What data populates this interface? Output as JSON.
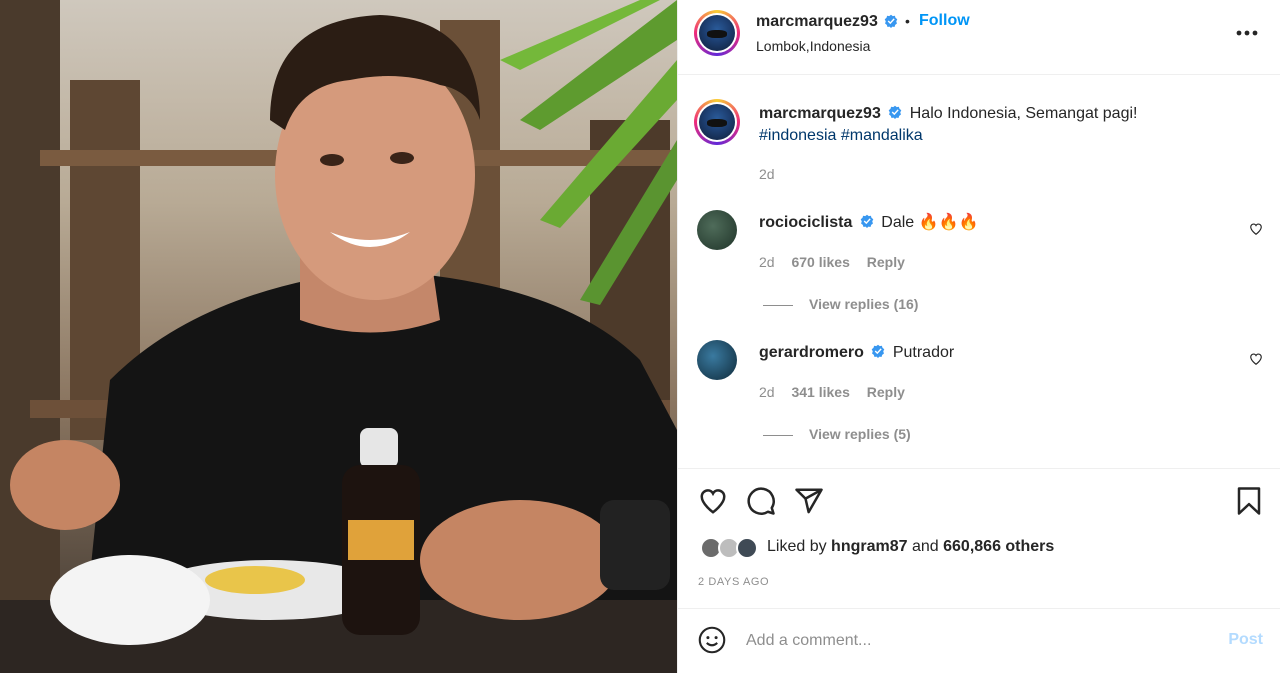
{
  "post": {
    "author": "marcmarquez93",
    "follow_label": "Follow",
    "separator": "•",
    "location": "Lombok,Indonesia",
    "more_label": "•••",
    "caption_text": "Halo Indonesia, Semangat pagi!",
    "hashtags": "#indonesia #mandalika",
    "caption_time": "2d"
  },
  "comments": [
    {
      "user": "rociociclista",
      "text": "Dale 🔥🔥🔥",
      "time": "2d",
      "likes": "670 likes",
      "reply_label": "Reply",
      "view_replies": "View replies (16)"
    },
    {
      "user": "gerardromero",
      "text": "Putrador",
      "time": "2d",
      "likes": "341 likes",
      "reply_label": "Reply",
      "view_replies": "View replies (5)"
    }
  ],
  "engagement": {
    "liked_by_prefix": "Liked by",
    "liked_by_user": "hngram87",
    "and_label": "and",
    "others_count": "660,866 others",
    "posted_ago": "2 DAYS AGO"
  },
  "comment_box": {
    "placeholder": "Add a comment...",
    "post_label": "Post"
  },
  "colors": {
    "accent": "#0095f6",
    "verified": "#3897f0",
    "hashtag": "#00376b",
    "muted": "#8e8e8e"
  },
  "icons": [
    "verified-icon",
    "more-icon",
    "heart-icon",
    "comment-icon",
    "share-icon",
    "bookmark-icon",
    "emoji-icon"
  ]
}
